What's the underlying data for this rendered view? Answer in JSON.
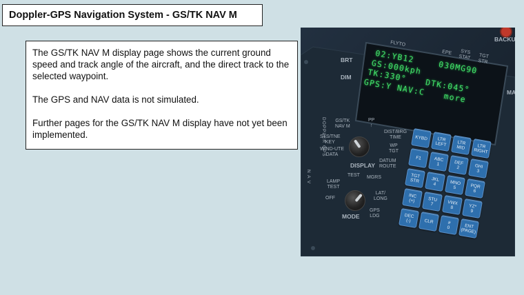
{
  "header": {
    "title": "Doppler-GPS Navigation System - GS/TK NAV M"
  },
  "description": {
    "paragraphs": [
      "The GS/TK NAV M display page shows the current ground speed and track angle of the aircraft, and the direct track to the selected waypoint.",
      "The GPS and NAV data is not simulated.",
      "Further pages for the GS/TK NAV M display have not yet been implemented."
    ]
  },
  "panel": {
    "top_labels": {
      "flyto": "FLYTO",
      "epe": "EPE",
      "sys_stat": "SYS\nSTAT",
      "tgt_str": "TGT\nSTR",
      "backup": "BACKUP"
    },
    "side_labels": {
      "brt": "BRT",
      "dim": "DIM",
      "ma": "MA"
    },
    "lcd": {
      "line1_left": "02:YB12",
      "line1_right": "030MG90",
      "line2_left": "GS:000kph",
      "line2_right": "",
      "line3_left": "TK:330°",
      "line3_right": "DTK:045°",
      "line4_left": "GPS:Y NAV:C",
      "line4_right": "more"
    },
    "display_selector": {
      "title": "DISPLAY",
      "positions": [
        "GS/TK\nNAV M",
        "PP\n↑",
        "DIST/BRG\nTIME",
        "WP\nTGT",
        "DATUM\nROUTE",
        "WIND-UTE\nDATA",
        "STS/TNE\nKEY"
      ],
      "vertical_label": "DOPPLER GPS"
    },
    "mode_selector": {
      "title": "MODE",
      "positions": [
        "TEST",
        "MGRS",
        "LAT/\nLONG",
        "GPS\nLDG",
        "OFF",
        "LAMP\nTEST"
      ],
      "vertical_label": "N A V"
    },
    "keypad": [
      [
        "KYBD",
        "LTR\nLEFT",
        "LTR\nMID",
        "LTR\nRIGHT"
      ],
      [
        "F1",
        "ABC\n1",
        "DEF\n2",
        "GHI\n3"
      ],
      [
        "TGT\nSTR",
        "JKL\n4",
        "MNO\n5",
        "PQR\n6"
      ],
      [
        "INC\n(+)",
        "STU\n7",
        "VWX\n8",
        "YZ*\n9"
      ],
      [
        "DEC\n(-)",
        "CLR",
        "#\n0",
        "ENT\n(PAGE)"
      ]
    ]
  }
}
